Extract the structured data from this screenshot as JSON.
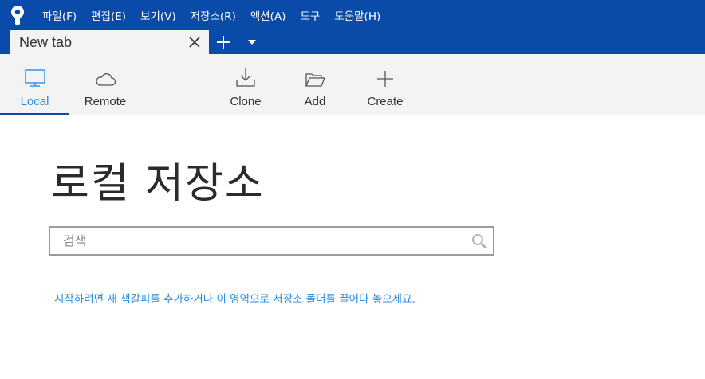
{
  "menubar": {
    "items": [
      {
        "label": "파일(F)"
      },
      {
        "label": "편집(E)"
      },
      {
        "label": "보기(V)"
      },
      {
        "label": "저장소(R)"
      },
      {
        "label": "액션(A)"
      },
      {
        "label": "도구"
      },
      {
        "label": "도움말(H)"
      }
    ]
  },
  "tabs": [
    {
      "label": "New tab",
      "active": true
    }
  ],
  "toolbar": {
    "local_label": "Local",
    "remote_label": "Remote",
    "clone_label": "Clone",
    "add_label": "Add",
    "create_label": "Create"
  },
  "main": {
    "title": "로컬 저장소",
    "search_placeholder": "검색",
    "hint": "시작하려면 새 책갈피를 추가하거나 이 영역으로 저장소 폴더를 끌어다 놓으세요."
  },
  "colors": {
    "brand": "#0a4aa8",
    "accent": "#2b8ce6",
    "toolbar_bg": "#f3f3f3"
  }
}
